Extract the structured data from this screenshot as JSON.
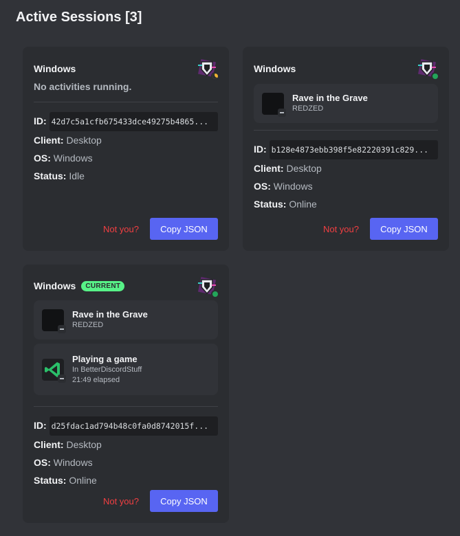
{
  "page_title": "Active Sessions [3]",
  "colors": {
    "background": "#313338",
    "card": "#2b2d31",
    "accent": "#5865f2",
    "danger": "#f23f42",
    "online": "#23a55a",
    "idle": "#f0b232",
    "current_badge": "#57f287"
  },
  "labels": {
    "id": "ID:",
    "client": "Client:",
    "os": "OS:",
    "status": "Status:",
    "not_you": "Not you?",
    "copy_json": "Copy JSON"
  },
  "sessions": [
    {
      "os_title": "Windows",
      "status_indicator": "idle",
      "no_activity_text": "No activities running.",
      "id": "42d7c5a1cfb675433dce49275b4865...",
      "client": "Desktop",
      "os": "Windows",
      "status": "Idle"
    },
    {
      "os_title": "Windows",
      "status_indicator": "online",
      "activities": [
        {
          "icon": "music-cover-icon",
          "title": "Rave in the Grave",
          "subtitle": "REDZED"
        }
      ],
      "id": "b128e4873ebb398f5e82220391c829...",
      "client": "Desktop",
      "os": "Windows",
      "status": "Online"
    },
    {
      "os_title": "Windows",
      "badge": "CURRENT",
      "status_indicator": "online",
      "activities": [
        {
          "icon": "music-cover-icon",
          "title": "Rave in the Grave",
          "subtitle": "REDZED"
        },
        {
          "icon": "vscode-icon",
          "title": "Playing a game",
          "subtitle": "In BetterDiscordStuff",
          "detail": "21:49 elapsed"
        }
      ],
      "id": "d25fdac1ad794b48c0fa0d8742015f...",
      "client": "Desktop",
      "os": "Windows",
      "status": "Online"
    }
  ]
}
